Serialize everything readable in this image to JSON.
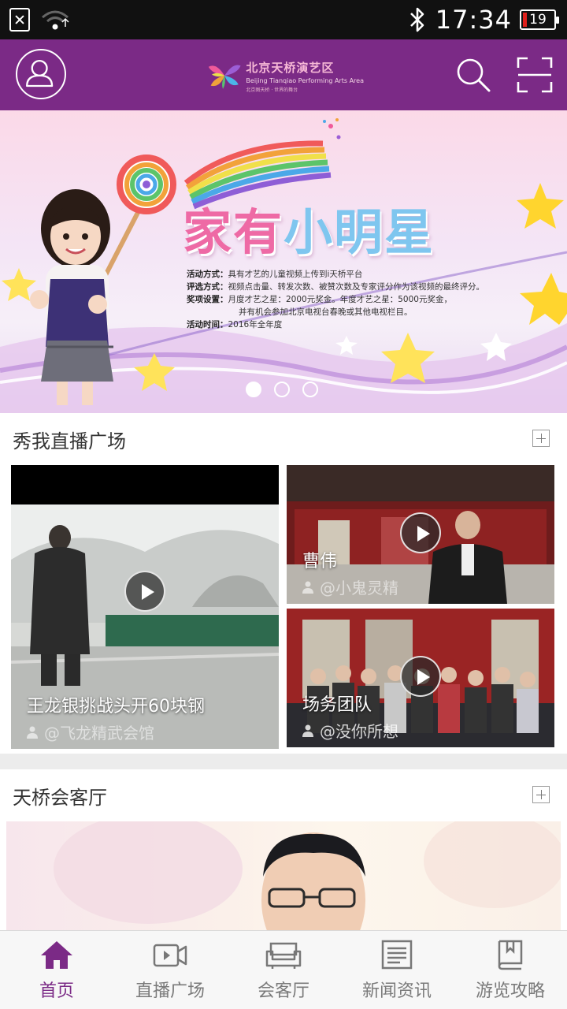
{
  "status_bar": {
    "time": "17:34",
    "battery": "19",
    "icons": [
      "no-sim-icon",
      "wifi-icon",
      "bluetooth-icon",
      "battery-icon"
    ]
  },
  "header": {
    "logo_cn": "北京天桥演艺区",
    "logo_en": "Beijing Tianqiao Performing Arts Area",
    "logo_sub": "北京图天桥 · 世界的舞台",
    "icons": [
      "user-icon",
      "search-icon",
      "scan-icon"
    ]
  },
  "banner": {
    "title_part1": "家有",
    "title_part2": "小明星",
    "lines": [
      {
        "label": "活动方式：",
        "text": "具有才艺的儿童视频上传到i天桥平台"
      },
      {
        "label": "评选方式：",
        "text": "视频点击量、转发次数、被赞次数及专家评分作为该视频的最终评分。"
      },
      {
        "label": "奖项设置：",
        "text": "月度才艺之星：2000元奖金。年度才艺之星：5000元奖金，"
      },
      {
        "label": "",
        "text": "并有机会参加北京电视台春晚或其他电视栏目。"
      },
      {
        "label": "活动时间：",
        "text": "2016年全年度"
      }
    ],
    "slide_count": 3,
    "active_slide": 1
  },
  "live_section": {
    "title": "秀我直播广场",
    "videos": [
      {
        "title": "王龙银挑战头开60块钢",
        "user": "@飞龙精武会馆"
      },
      {
        "title": "曹伟",
        "user": "@小鬼灵精"
      },
      {
        "title": "场务团队",
        "user": "@没你所想"
      }
    ]
  },
  "guest_section": {
    "title": "天桥会客厅"
  },
  "tabs": [
    {
      "label": "首页",
      "icon": "home-icon",
      "active": true
    },
    {
      "label": "直播广场",
      "icon": "video-camera-icon",
      "active": false
    },
    {
      "label": "会客厅",
      "icon": "sofa-icon",
      "active": false
    },
    {
      "label": "新闻资讯",
      "icon": "news-icon",
      "active": false
    },
    {
      "label": "游览攻略",
      "icon": "guidebook-icon",
      "active": false
    }
  ],
  "colors": {
    "brand_purple": "#7b2a86",
    "status_bar": "#111111",
    "tab_inactive": "#7a7a7a"
  }
}
